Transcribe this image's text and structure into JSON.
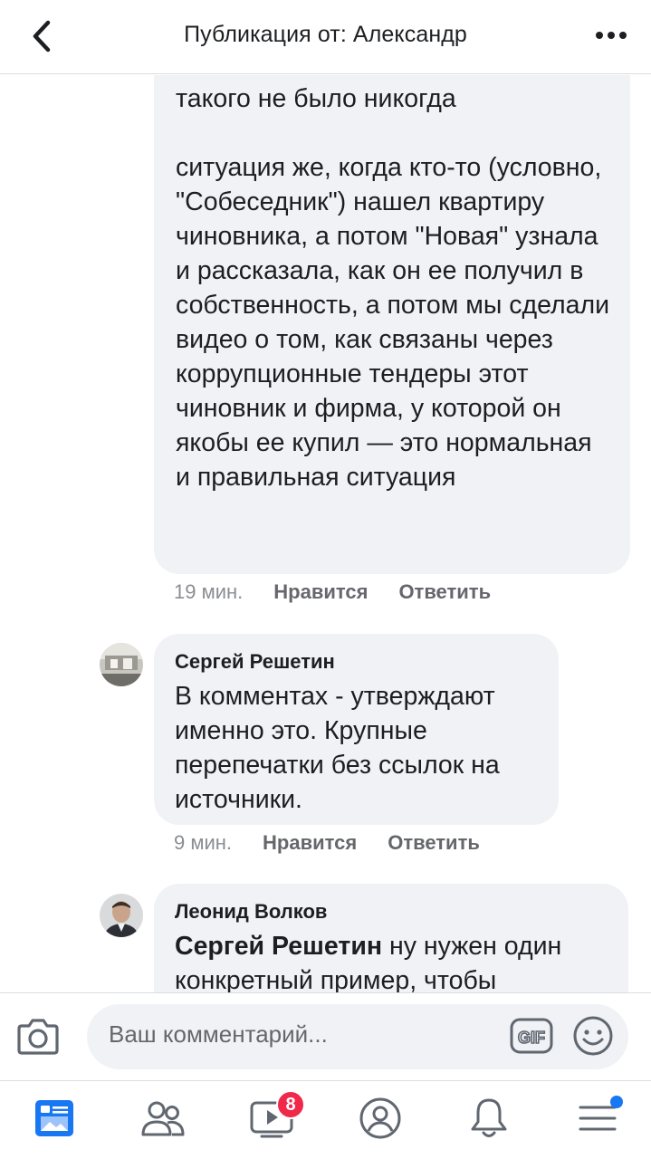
{
  "header": {
    "title": "Публикация от: Александр",
    "back_icon": "chevron-left-icon",
    "more_icon": "more-horizontal-icon"
  },
  "comments": [
    {
      "text": "такого не было никогда\n\nситуация же, когда кто-то (условно, \"Собеседник\") нашел квартиру чиновника, а потом \"Новая\" узнала и рассказала, как он ее получил в собственность, а потом мы сделали видео о том, как связаны через коррупционные тендеры этот чиновник и фирма, у которой он якобы ее купил — это нормальная и правильная ситуация",
      "time": "19 мин.",
      "like": "Нравится",
      "reply": "Ответить"
    },
    {
      "author": "Сергей Решетин",
      "text": "В комментах - утверждают именно это. Крупные перепечатки без ссылок на источники.",
      "time": "9 мин.",
      "like": "Нравится",
      "reply": "Ответить"
    },
    {
      "author": "Леонид Волков",
      "mention": "Сергей Решетин",
      "text": " ну нужен один конкретный пример, чтобы"
    }
  ],
  "composer": {
    "placeholder": "Ваш комментарий...",
    "gif_label": "GIF",
    "camera_icon": "camera-icon",
    "emoji_icon": "smiley-icon"
  },
  "tabbar": {
    "items": [
      "news-feed-icon",
      "friends-icon",
      "watch-icon",
      "profile-icon",
      "notifications-icon",
      "menu-icon"
    ],
    "watch_badge": "8",
    "accent": "#1877f2",
    "badge_color": "#f02849"
  }
}
